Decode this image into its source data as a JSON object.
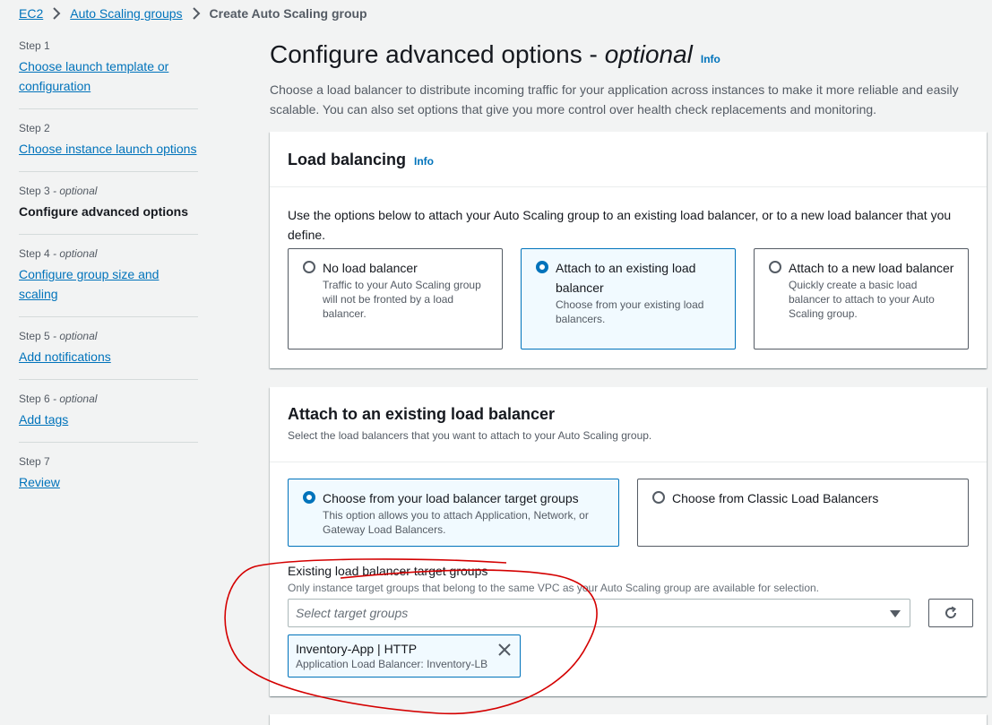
{
  "breadcrumb": {
    "items": [
      "EC2",
      "Auto Scaling groups"
    ],
    "current": "Create Auto Scaling group"
  },
  "steps": [
    {
      "label": "Step 1",
      "optional": "",
      "title": "Choose launch template or configuration",
      "active": false
    },
    {
      "label": "Step 2",
      "optional": "",
      "title": "Choose instance launch options",
      "active": false
    },
    {
      "label": "Step 3",
      "optional": " - optional",
      "title": "Configure advanced options",
      "active": true
    },
    {
      "label": "Step 4",
      "optional": " - optional",
      "title": "Configure group size and scaling",
      "active": false
    },
    {
      "label": "Step 5",
      "optional": " - optional",
      "title": "Add notifications",
      "active": false
    },
    {
      "label": "Step 6",
      "optional": " - optional",
      "title": "Add tags",
      "active": false
    },
    {
      "label": "Step 7",
      "optional": "",
      "title": "Review",
      "active": false
    }
  ],
  "page": {
    "title": "Configure advanced options - ",
    "title_italic": "optional",
    "info": "Info",
    "description": "Choose a load balancer to distribute incoming traffic for your application across instances to make it more reliable and easily scalable. You can also set options that give you more control over health check replacements and monitoring."
  },
  "load_balancing": {
    "title": "Load balancing",
    "info": "Info",
    "intro": "Use the options below to attach your Auto Scaling group to an existing load balancer, or to a new load balancer that you define.",
    "options": [
      {
        "title": "No load balancer",
        "desc": "Traffic to your Auto Scaling group will not be fronted by a load balancer.",
        "selected": false
      },
      {
        "title": "Attach to an existing load balancer",
        "desc": "Choose from your existing load balancers.",
        "selected": true
      },
      {
        "title": "Attach to a new load balancer",
        "desc": "Quickly create a basic load balancer to attach to your Auto Scaling group.",
        "selected": false
      }
    ]
  },
  "attach_existing": {
    "title": "Attach to an existing load balancer",
    "subtitle": "Select the load balancers that you want to attach to your Auto Scaling group.",
    "options": [
      {
        "title": "Choose from your load balancer target groups",
        "desc": "This option allows you to attach Application, Network, or Gateway Load Balancers.",
        "selected": true
      },
      {
        "title": "Choose from Classic Load Balancers",
        "desc": "",
        "selected": false
      }
    ],
    "target_groups_label": "Existing load balancer target groups",
    "target_groups_desc": "Only instance target groups that belong to the same VPC as your Auto Scaling group are available for selection.",
    "select_placeholder": "Select target groups",
    "token": {
      "title": "Inventory-App | HTTP",
      "desc": "Application Load Balancer: Inventory-LB"
    }
  },
  "colors": {
    "link": "#0073bb",
    "annotation": "#d40000"
  }
}
